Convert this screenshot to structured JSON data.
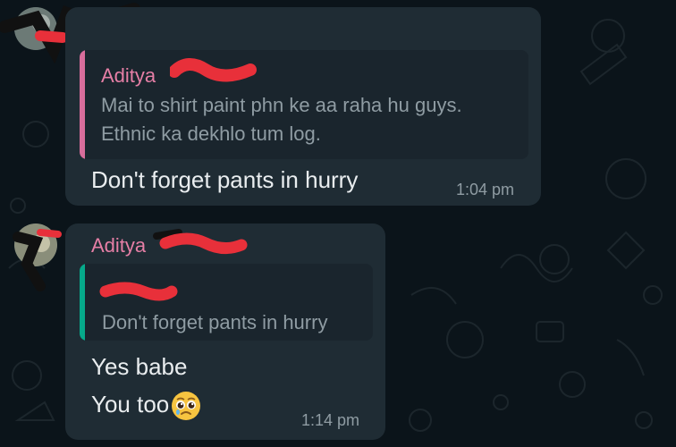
{
  "colors": {
    "background": "#0b141a",
    "bubble": "#1f2c34",
    "quote_bg": "#1a252d",
    "sender_pink": "#e67fa6",
    "quote_bar_pink": "#d86d9b",
    "quote_bar_teal": "#06a98a",
    "redaction_red": "#e8303a"
  },
  "messages": [
    {
      "quote": {
        "name": "Aditya",
        "text_line1": "Mai to shirt paint phn ke aa raha hu guys.",
        "text_line2": "Ethnic ka dekhlo tum log."
      },
      "text": "Don't forget pants in hurry",
      "time": "1:04 pm"
    },
    {
      "sender": "Aditya",
      "quote": {
        "text": "Don't forget pants in hurry"
      },
      "text_line1": "Yes babe",
      "text_line2": "You too",
      "emoji": "crying-face-emoji",
      "time": "1:14 pm"
    }
  ]
}
